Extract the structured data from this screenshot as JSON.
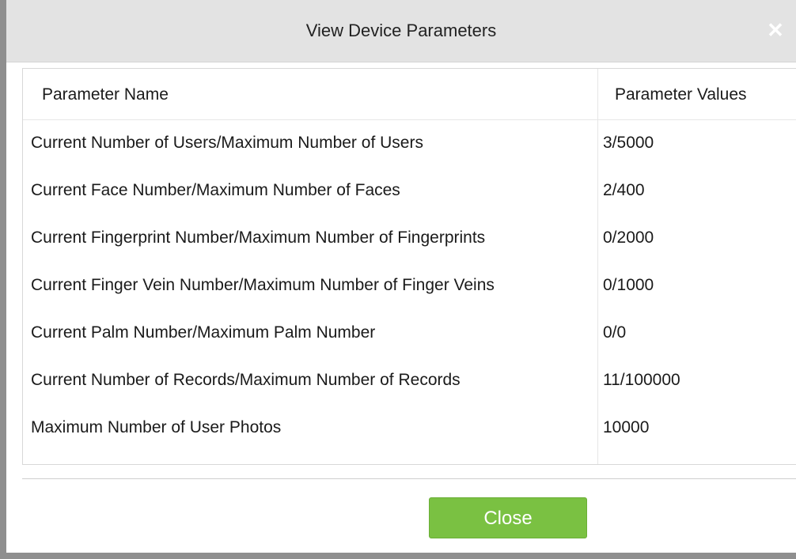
{
  "dialog": {
    "title": "View Device Parameters",
    "close_icon": "close-icon",
    "close_glyph": "✕"
  },
  "table": {
    "headers": {
      "name": "Parameter Name",
      "value": "Parameter Values"
    },
    "rows": [
      {
        "name": "Current Number of Users/Maximum Number of Users",
        "value": "3/5000"
      },
      {
        "name": "Current Face Number/Maximum Number of Faces",
        "value": "2/400"
      },
      {
        "name": "Current Fingerprint Number/Maximum Number of Fingerprints",
        "value": "0/2000"
      },
      {
        "name": "Current Finger Vein Number/Maximum Number of Finger Veins",
        "value": "0/1000"
      },
      {
        "name": "Current Palm Number/Maximum Palm Number",
        "value": "0/0"
      },
      {
        "name": "Current Number of Records/Maximum Number of Records",
        "value": "11/100000"
      },
      {
        "name": "Maximum Number of User Photos",
        "value": "10000"
      }
    ]
  },
  "footer": {
    "close_label": "Close"
  },
  "colors": {
    "titlebar": "#e3e3e3",
    "button_green": "#7ac142"
  }
}
